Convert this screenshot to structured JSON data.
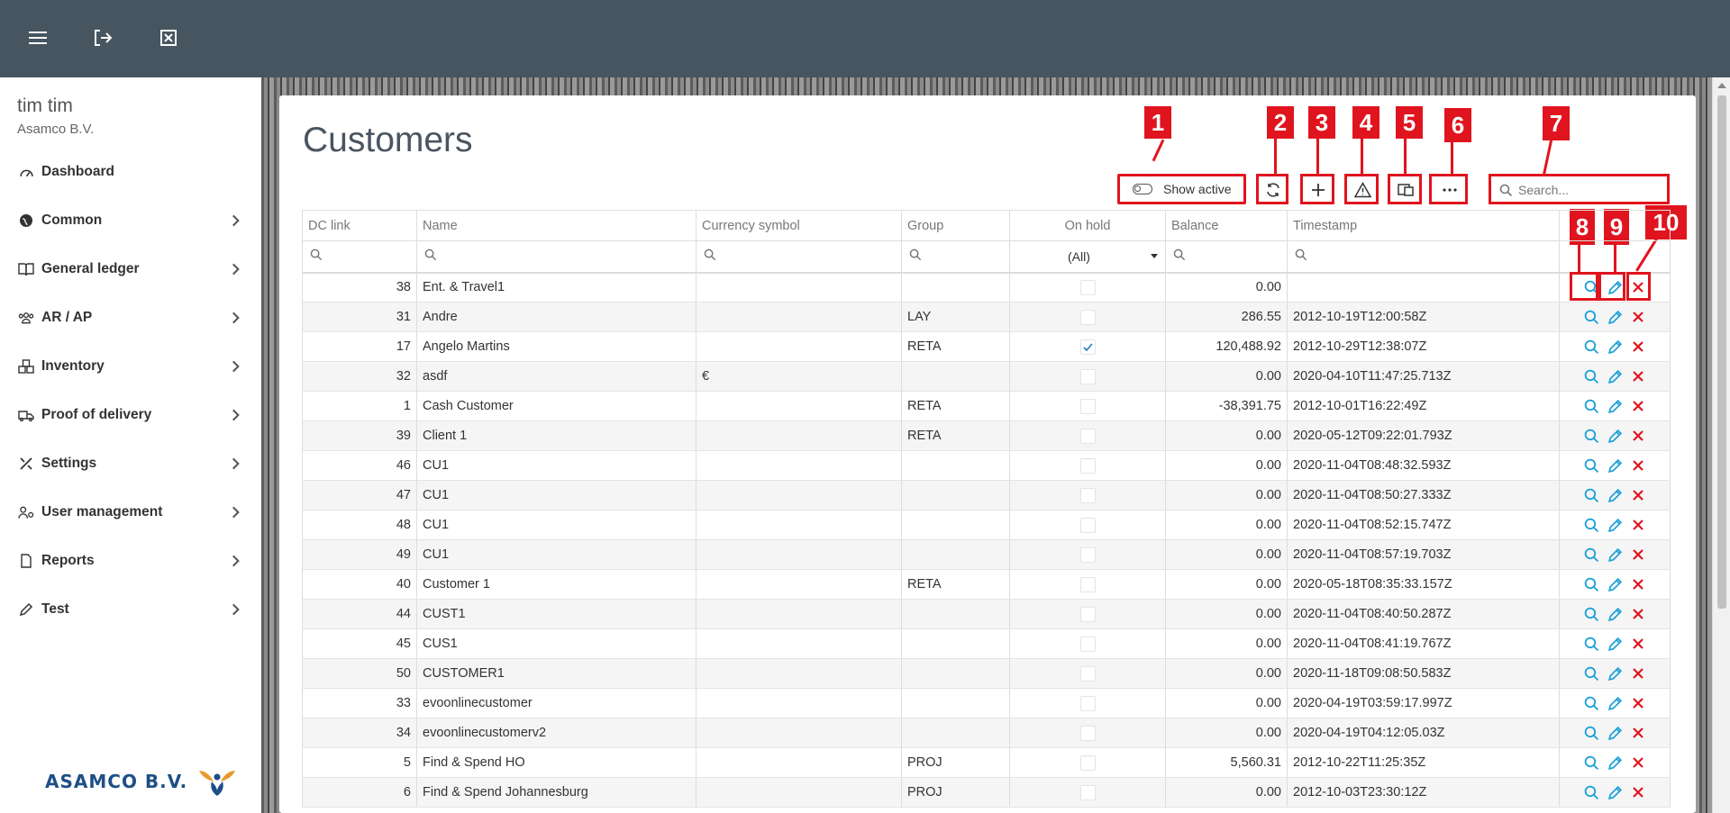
{
  "user": {
    "name": "tim tim",
    "company": "Asamco B.V."
  },
  "topbar": {
    "icons": [
      "menu-icon",
      "logout-icon",
      "close-window-icon"
    ]
  },
  "nav": [
    {
      "label": "Dashboard",
      "icon": "dashboard-icon"
    },
    {
      "label": "Common",
      "icon": "globe-icon"
    },
    {
      "label": "General ledger",
      "icon": "book-icon"
    },
    {
      "label": "AR / AP",
      "icon": "users-icon"
    },
    {
      "label": "Inventory",
      "icon": "boxes-icon"
    },
    {
      "label": "Proof of delivery",
      "icon": "truck-icon"
    },
    {
      "label": "Settings",
      "icon": "tools-icon"
    },
    {
      "label": "User management",
      "icon": "user-cog-icon"
    },
    {
      "label": "Reports",
      "icon": "file-icon"
    },
    {
      "label": "Test",
      "icon": "pen-icon"
    }
  ],
  "logo": {
    "text": "ASAMCO B.V."
  },
  "page": {
    "title": "Customers"
  },
  "toolbar": {
    "show_active_label": "Show active",
    "search_placeholder": "Search..."
  },
  "callouts": [
    "1",
    "2",
    "3",
    "4",
    "5",
    "6",
    "7",
    "8",
    "9",
    "10"
  ],
  "table": {
    "columns": [
      "DC link",
      "Name",
      "Currency symbol",
      "Group",
      "On hold",
      "Balance",
      "Timestamp"
    ],
    "on_hold_filter": "(All)",
    "rows": [
      {
        "dc": "38",
        "name": "Ent. & Travel1",
        "cur": "",
        "group": "",
        "hold": false,
        "balance": "0.00",
        "ts": ""
      },
      {
        "dc": "31",
        "name": "Andre",
        "cur": "",
        "group": "LAY",
        "hold": false,
        "balance": "286.55",
        "ts": "2012-10-19T12:00:58Z"
      },
      {
        "dc": "17",
        "name": "Angelo Martins",
        "cur": "",
        "group": "RETA",
        "hold": true,
        "balance": "120,488.92",
        "ts": "2012-10-29T12:38:07Z"
      },
      {
        "dc": "32",
        "name": "asdf",
        "cur": "€",
        "group": "",
        "hold": false,
        "balance": "0.00",
        "ts": "2020-04-10T11:47:25.713Z"
      },
      {
        "dc": "1",
        "name": "Cash Customer",
        "cur": "",
        "group": "RETA",
        "hold": false,
        "balance": "-38,391.75",
        "ts": "2012-10-01T16:22:49Z"
      },
      {
        "dc": "39",
        "name": "Client 1",
        "cur": "",
        "group": "RETA",
        "hold": false,
        "balance": "0.00",
        "ts": "2020-05-12T09:22:01.793Z"
      },
      {
        "dc": "46",
        "name": "CU1",
        "cur": "",
        "group": "",
        "hold": false,
        "balance": "0.00",
        "ts": "2020-11-04T08:48:32.593Z"
      },
      {
        "dc": "47",
        "name": "CU1",
        "cur": "",
        "group": "",
        "hold": false,
        "balance": "0.00",
        "ts": "2020-11-04T08:50:27.333Z"
      },
      {
        "dc": "48",
        "name": "CU1",
        "cur": "",
        "group": "",
        "hold": false,
        "balance": "0.00",
        "ts": "2020-11-04T08:52:15.747Z"
      },
      {
        "dc": "49",
        "name": "CU1",
        "cur": "",
        "group": "",
        "hold": false,
        "balance": "0.00",
        "ts": "2020-11-04T08:57:19.703Z"
      },
      {
        "dc": "40",
        "name": "Customer 1",
        "cur": "",
        "group": "RETA",
        "hold": false,
        "balance": "0.00",
        "ts": "2020-05-18T08:35:33.157Z"
      },
      {
        "dc": "44",
        "name": "CUST1",
        "cur": "",
        "group": "",
        "hold": false,
        "balance": "0.00",
        "ts": "2020-11-04T08:40:50.287Z"
      },
      {
        "dc": "45",
        "name": "CUS1",
        "cur": "",
        "group": "",
        "hold": false,
        "balance": "0.00",
        "ts": "2020-11-04T08:41:19.767Z"
      },
      {
        "dc": "50",
        "name": "CUSTOMER1",
        "cur": "",
        "group": "",
        "hold": false,
        "balance": "0.00",
        "ts": "2020-11-18T09:08:50.583Z"
      },
      {
        "dc": "33",
        "name": "evoonlinecustomer",
        "cur": "",
        "group": "",
        "hold": false,
        "balance": "0.00",
        "ts": "2020-04-19T03:59:17.997Z"
      },
      {
        "dc": "34",
        "name": "evoonlinecustomerv2",
        "cur": "",
        "group": "",
        "hold": false,
        "balance": "0.00",
        "ts": "2020-04-19T04:12:05.03Z"
      },
      {
        "dc": "5",
        "name": "Find & Spend HO",
        "cur": "",
        "group": "PROJ",
        "hold": false,
        "balance": "5,560.31",
        "ts": "2012-10-22T11:25:35Z"
      },
      {
        "dc": "6",
        "name": "Find & Spend Johannesburg",
        "cur": "",
        "group": "PROJ",
        "hold": false,
        "balance": "0.00",
        "ts": "2012-10-03T23:30:12Z"
      }
    ]
  },
  "colors": {
    "topbar": "#46555f",
    "accent": "#1a9fd9",
    "danger": "#e0141e",
    "callout": "#e0141e"
  }
}
